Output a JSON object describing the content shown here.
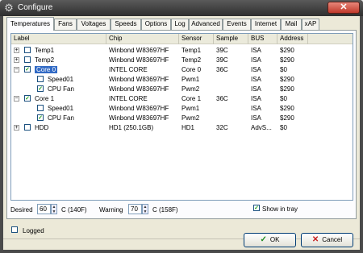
{
  "window": {
    "title": "Configure"
  },
  "tabs": [
    {
      "label": "Temperatures",
      "active": true
    },
    {
      "label": "Fans"
    },
    {
      "label": "Voltages"
    },
    {
      "label": "Speeds"
    },
    {
      "label": "Options"
    },
    {
      "label": "Log"
    },
    {
      "label": "Advanced"
    },
    {
      "label": "Events"
    },
    {
      "label": "Internet"
    },
    {
      "label": "Mail"
    },
    {
      "label": "xAP"
    }
  ],
  "columns": [
    "Label",
    "Chip",
    "Sensor",
    "Sample",
    "BUS",
    "Address"
  ],
  "rows": [
    {
      "expander": "+",
      "checked": false,
      "label": "Temp1",
      "chip": "Winbond W83697HF",
      "sensor": "Temp1",
      "sample": "39C",
      "bus": "ISA",
      "address": "$290"
    },
    {
      "expander": "+",
      "checked": false,
      "label": "Temp2",
      "chip": "Winbond W83697HF",
      "sensor": "Temp2",
      "sample": "39C",
      "bus": "ISA",
      "address": "$290"
    },
    {
      "expander": "−",
      "checked": true,
      "label": "Core 0",
      "selected": true,
      "chip": "INTEL CORE",
      "sensor": "Core 0",
      "sample": "36C",
      "bus": "ISA",
      "address": "$0"
    },
    {
      "child": true,
      "checked": false,
      "label": "Speed01",
      "chip": "Winbond W83697HF",
      "sensor": "Pwm1",
      "sample": "",
      "bus": "ISA",
      "address": "$290"
    },
    {
      "child": true,
      "checked": true,
      "label": "CPU Fan",
      "chip": "Winbond W83697HF",
      "sensor": "Pwm2",
      "sample": "",
      "bus": "ISA",
      "address": "$290"
    },
    {
      "expander": "−",
      "checked": true,
      "label": "Core 1",
      "chip": "INTEL CORE",
      "sensor": "Core 1",
      "sample": "36C",
      "bus": "ISA",
      "address": "$0"
    },
    {
      "child": true,
      "checked": false,
      "label": "Speed01",
      "chip": "Winbond W83697HF",
      "sensor": "Pwm1",
      "sample": "",
      "bus": "ISA",
      "address": "$290"
    },
    {
      "child": true,
      "checked": true,
      "label": "CPU Fan",
      "chip": "Winbond W83697HF",
      "sensor": "Pwm2",
      "sample": "",
      "bus": "ISA",
      "address": "$290"
    },
    {
      "expander": "+",
      "checked": false,
      "label": "HDD",
      "chip": "HD1 (250.1GB)",
      "sensor": "HD1",
      "sample": "32C",
      "bus": "AdvS...",
      "address": "$0"
    }
  ],
  "settings": {
    "desired_label": "Desired",
    "desired_value": "60",
    "desired_unit": "C (140F)",
    "warning_label": "Warning",
    "warning_value": "70",
    "warning_unit": "C (158F)",
    "show_in_tray_label": "Show in tray",
    "show_in_tray_checked": true,
    "logged_label": "Logged",
    "logged_checked": false
  },
  "buttons": {
    "ok": "OK",
    "cancel": "Cancel"
  },
  "icons": {
    "app": "gear-icon",
    "close": "close-icon",
    "ok": "checkmark-icon",
    "cancel": "cross-icon"
  }
}
